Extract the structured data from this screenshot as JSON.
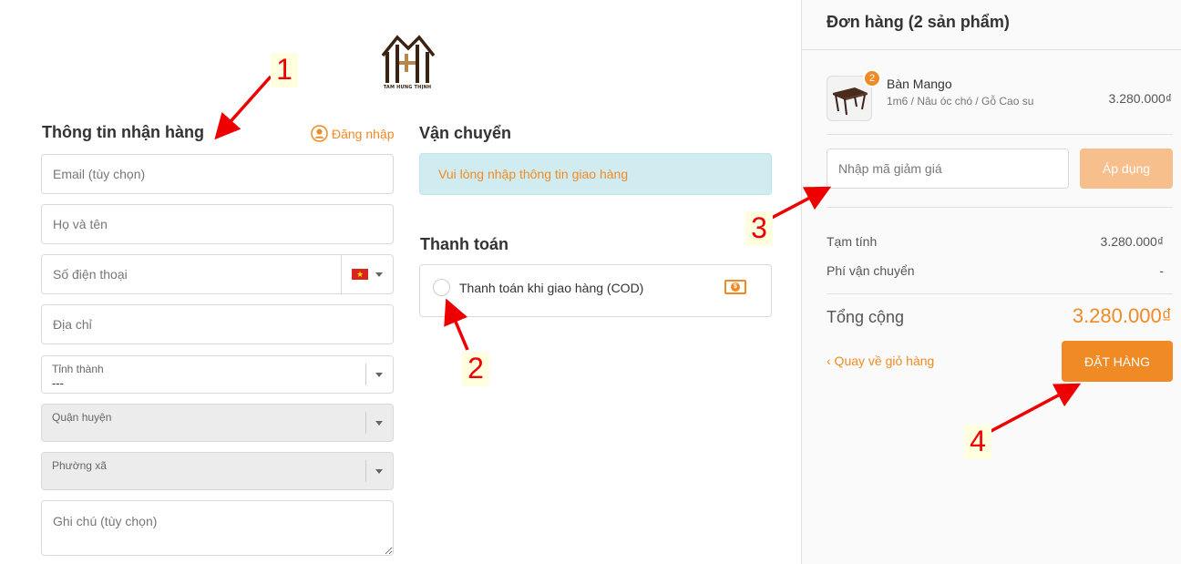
{
  "logo": {
    "caption": "TAM HƯNG THỊNH",
    "icon": "house-logo"
  },
  "contact": {
    "title": "Thông tin nhận hàng",
    "login_label": "Đăng nhập",
    "login_icon": "user-circle-icon",
    "email_placeholder": "Email (tùy chọn)",
    "name_placeholder": "Họ và tên",
    "phone_placeholder": "Số điện thoại",
    "phone_country_icon": "vietnam-flag-icon",
    "address_placeholder": "Địa chỉ",
    "province": {
      "label": "Tỉnh thành",
      "value": "---"
    },
    "district": {
      "label": "Quận huyện"
    },
    "ward": {
      "label": "Phường xã"
    },
    "note_placeholder": "Ghi chú (tùy chọn)"
  },
  "shipping": {
    "title": "Vận chuyển",
    "notice": "Vui lòng nhập thông tin giao hàng"
  },
  "payment": {
    "title": "Thanh toán",
    "cod_label": "Thanh toán khi giao hàng (COD)",
    "cod_icon": "cash-icon"
  },
  "order": {
    "title": "Đơn hàng (2 sản phẩm)",
    "item": {
      "name": "Bàn Mango",
      "variant": "1m6 / Nâu óc chó / Gỗ Cao su",
      "price": "3.280.000₫",
      "quantity": "2"
    },
    "coupon_placeholder": "Nhập mã giảm giá",
    "apply_label": "Áp dụng",
    "subtotal_label": "Tạm tính",
    "subtotal_value": "3.280.000₫",
    "shipping_label": "Phí vận chuyển",
    "shipping_value": "-",
    "total_label": "Tổng cộng",
    "total_value": "3.280.000₫",
    "back_label": "‹ Quay về giỏ hàng",
    "place_order_label": "ĐẶT HÀNG"
  },
  "annotations": [
    "1",
    "2",
    "3",
    "4"
  ],
  "colors": {
    "accent": "#f08a24",
    "annotation": "#e00000",
    "notice_bg": "#d1ecf1"
  }
}
